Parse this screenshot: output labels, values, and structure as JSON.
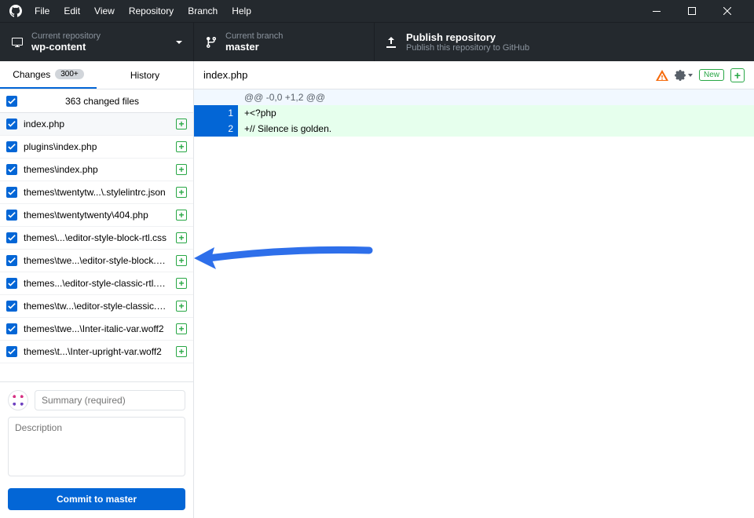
{
  "menu": {
    "items": [
      "File",
      "Edit",
      "View",
      "Repository",
      "Branch",
      "Help"
    ]
  },
  "toolbar": {
    "repo": {
      "label": "Current repository",
      "value": "wp-content"
    },
    "branch": {
      "label": "Current branch",
      "value": "master"
    },
    "publish": {
      "label": "Publish repository",
      "value": "Publish this repository to GitHub"
    }
  },
  "tabs": {
    "changes": "Changes",
    "changes_badge": "300+",
    "history": "History"
  },
  "changed_files_text": "363 changed files",
  "files": [
    "index.php",
    "plugins\\index.php",
    "themes\\index.php",
    "themes\\twentytw...\\.stylelintrc.json",
    "themes\\twentytwenty\\404.php",
    "themes\\...\\editor-style-block-rtl.css",
    "themes\\twe...\\editor-style-block.css",
    "themes...\\editor-style-classic-rtl.css",
    "themes\\tw...\\editor-style-classic.css",
    "themes\\twe...\\Inter-italic-var.woff2",
    "themes\\t...\\Inter-upright-var.woff2"
  ],
  "commit": {
    "summary_placeholder": "Summary (required)",
    "description_placeholder": "Description",
    "button_prefix": "Commit to ",
    "button_branch": "master"
  },
  "diff": {
    "filename": "index.php",
    "new_label": "New",
    "hunk": "@@ -0,0 +1,2 @@",
    "lines": [
      {
        "n": "1",
        "text": "+<?php"
      },
      {
        "n": "2",
        "text": "+// Silence is golden."
      }
    ]
  }
}
